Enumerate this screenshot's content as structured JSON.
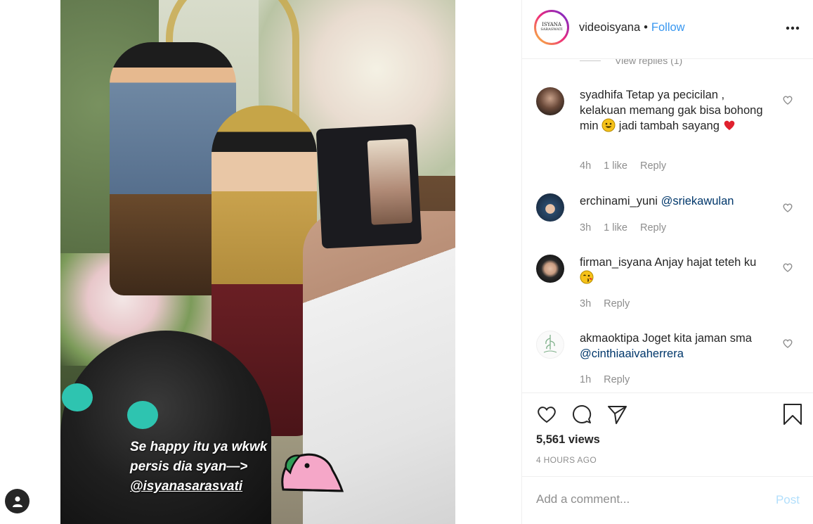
{
  "post": {
    "username": "videoisyana",
    "separator": "•",
    "follow_label": "Follow",
    "avatar_text_line1": "ISYANA",
    "avatar_text_line2": "SARASWATI",
    "views": "5,561 views",
    "time_ago": "4 HOURS AGO"
  },
  "media": {
    "caption_line1": "Se happy itu ya wkwk",
    "caption_line2": "persis dia syan—>",
    "caption_line3": "@isyanasarasvati"
  },
  "comments_section": {
    "view_replies": "View replies (1)",
    "comments": [
      {
        "username": "syadhifa",
        "text_part1": "Tetap ya pecicilan , kelakuan memang gak bisa bohong min",
        "text_part2": "jadi tambah sayang",
        "time": "4h",
        "likes": "1 like",
        "reply": "Reply"
      },
      {
        "username": "erchinami_yuni",
        "mention": "@sriekawulan",
        "time": "3h",
        "likes": "1 like",
        "reply": "Reply"
      },
      {
        "username": "firman_isyana",
        "text": "Anjay hajat teteh ku",
        "time": "3h",
        "reply": "Reply"
      },
      {
        "username": "akmaoktipa",
        "text": "Joget kita jaman sma",
        "mention": "@cinthiaaivaherrera",
        "time": "1h",
        "reply": "Reply"
      }
    ]
  },
  "add_comment": {
    "placeholder": "Add a comment...",
    "post_label": "Post"
  },
  "colors": {
    "link_blue": "#3897f0",
    "mention_blue": "#00376b",
    "muted": "#8e8e8e",
    "post_disabled": "#b2dffc"
  },
  "icons": {
    "more": "more-horizontal-icon",
    "like": "heart-icon",
    "comment": "comment-bubble-icon",
    "share": "paper-plane-icon",
    "save": "bookmark-icon",
    "profile": "user-icon"
  }
}
